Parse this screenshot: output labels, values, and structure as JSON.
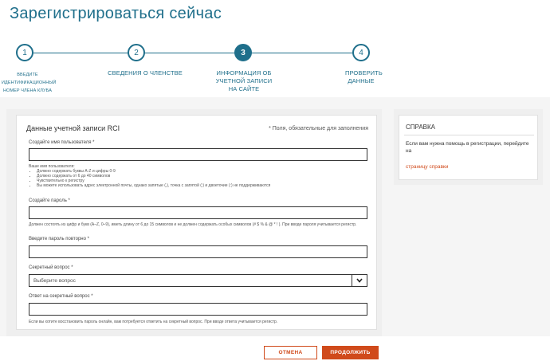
{
  "page": {
    "title": "Зарегистрироваться сейчас"
  },
  "steps": [
    {
      "number": "1",
      "label": "ВВЕДИТЕ ИДЕНТИФИКАЦИОННЫЙ НОМЕР ЧЛЕНА КЛУБА"
    },
    {
      "number": "2",
      "label": "СВЕДЕНИЯ О ЧЛЕНСТВЕ"
    },
    {
      "number": "3",
      "label": "ИНФОРМАЦИЯ ОБ УЧЕТНОЙ ЗАПИСИ НА САЙТЕ"
    },
    {
      "number": "4",
      "label": "ПРОВЕРИТЬ ДАННЫЕ"
    }
  ],
  "form": {
    "title": "Данные учетной записи RCI",
    "required_note": "* Поля, обязательные для заполнения",
    "username": {
      "label": "Создайте имя пользователя *",
      "value": "",
      "hint_intro": "Ваше имя пользователя:",
      "hints": [
        "Должно содержать буквы A-Z и цифры 0-9",
        "Должно содержать от 6 до 40 символов",
        "Чувствительно к регистру",
        "Вы можете использовать адрес электронной почты, однако запятые (,), точка с запятой (;) и двоеточие (:) не поддерживаются"
      ]
    },
    "password": {
      "label": "Создайте пароль *",
      "value": "",
      "hint": "Должен состоять из цифр и букв (A–Z, 0–9), иметь длину от 6 до 15 символов и не должен содержать особых символов (# $ % & @ * ! ). При вводе пароля учитывается регистр."
    },
    "password_repeat": {
      "label": "Введите пароль повторно *",
      "value": ""
    },
    "secret_question": {
      "label": "Секретный вопрос *",
      "selected": "Выберите вопрос"
    },
    "secret_answer": {
      "label": "Ответ на секретный вопрос *",
      "value": "",
      "hint": "Если вы хотите восстановить пароль онлайн, вам потребуется ответить на секретный вопрос. При вводе ответа учитывается регистр."
    }
  },
  "help": {
    "title": "СПРАВКА",
    "text": "Если вам нужна помощь в регистрации, перейдите на",
    "link": "страницу справки"
  },
  "buttons": {
    "cancel": "ОТМЕНА",
    "continue": "ПРОДОЛЖИТЬ"
  },
  "colors": {
    "accent": "#1f6f8b",
    "action": "#d04a1b"
  },
  "icons": {
    "select_arrow": "chevron-down-icon"
  }
}
